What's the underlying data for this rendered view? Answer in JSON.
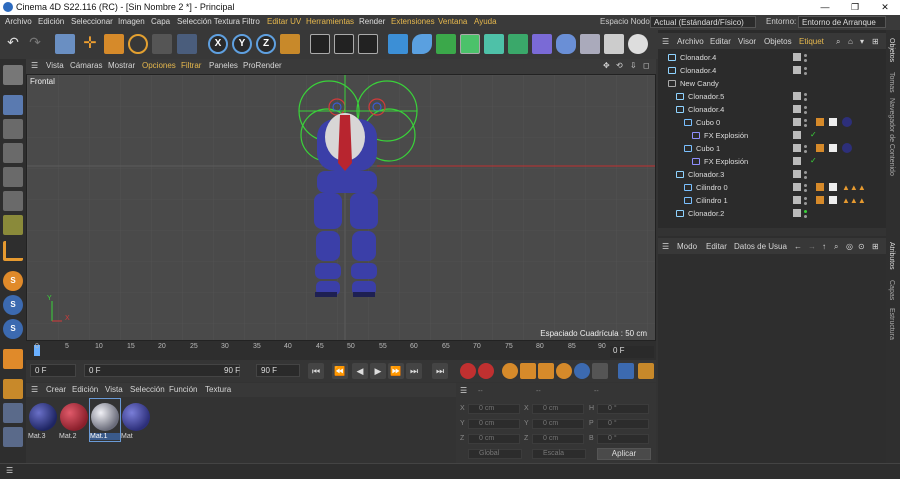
{
  "window": {
    "title": "Cinema 4D S22.116 (RC) - [Sin Nombre 2 *] - Principal",
    "controls": [
      "—",
      "❐",
      "✕"
    ]
  },
  "menubar": {
    "items": [
      "Archivo",
      "Edición",
      "Seleccionar",
      "Imagen",
      "Capa",
      "Selección Textura",
      "Filtro",
      "Editar UV",
      "Herramientas",
      "Render",
      "Extensiones",
      "Ventana",
      "Ayuda"
    ],
    "node_space_label": "Espacio Nodo:",
    "node_space_value": "Actual (Estándard/Físico)",
    "layout_label": "Entorno:",
    "layout_value": "Entorno de Arranque",
    "colors": {
      "accent": "#e6b84d"
    }
  },
  "toolbar": {
    "axis_labels": [
      "X",
      "Y",
      "Z"
    ]
  },
  "viewport": {
    "menu": [
      "Vista",
      "Cámaras",
      "Mostrar",
      "Opciones",
      "Filtrar",
      "Paneles",
      "ProRender"
    ],
    "view_name": "Frontal",
    "grid_spacing": "Espaciado Cuadrícula : 50 cm",
    "axis_x": "X",
    "axis_y": "Y",
    "nav_icons": [
      "✥",
      "⟲",
      "⇩",
      "◻"
    ]
  },
  "timeline": {
    "ticks": [
      "0",
      "5",
      "10",
      "15",
      "20",
      "25",
      "30",
      "35",
      "40",
      "45",
      "50",
      "55",
      "60",
      "65",
      "70",
      "75",
      "80",
      "85",
      "90"
    ],
    "current_frame": "0 F"
  },
  "playback": {
    "start": "0 F",
    "current": "0 F",
    "end_range": "90 F",
    "end": "90 F",
    "buttons": [
      "⏮",
      "⏪",
      "◀",
      "▶",
      "⏩",
      "⏭",
      "⏭"
    ]
  },
  "materials": {
    "menu": [
      "Crear",
      "Edición",
      "Vista",
      "Selección",
      "Función",
      "Textura"
    ],
    "items": [
      {
        "name": "Mat.3",
        "color": "#1e2563"
      },
      {
        "name": "Mat.2",
        "color": "#8a1f2b"
      },
      {
        "name": "Mat.1",
        "color": "#9ea0ad"
      },
      {
        "name": "Mat",
        "color": "#2d2f7a"
      }
    ]
  },
  "coords": {
    "header": [
      "--",
      "--",
      "--"
    ],
    "rows": [
      {
        "a": "X",
        "av": "0 cm",
        "b": "X",
        "bv": "0 cm",
        "c": "H",
        "cv": "0 °"
      },
      {
        "a": "Y",
        "av": "0 cm",
        "b": "Y",
        "bv": "0 cm",
        "c": "P",
        "cv": "0 °"
      },
      {
        "a": "Z",
        "av": "0 cm",
        "b": "Z",
        "bv": "0 cm",
        "c": "B",
        "cv": "0 °"
      }
    ],
    "mode1": "Global",
    "mode2": "Escala",
    "apply": "Aplicar"
  },
  "objects": {
    "menu": [
      "Archivo",
      "Editar",
      "Visor",
      "Objetos",
      "Etiquet"
    ],
    "rows": [
      {
        "name": "Clonador.4",
        "indent": 0
      },
      {
        "name": "Clonador.4",
        "indent": 0
      },
      {
        "name": "New Candy",
        "indent": 0
      },
      {
        "name": "Clonador.5",
        "indent": 1
      },
      {
        "name": "Clonador.4",
        "indent": 1
      },
      {
        "name": "Cubo 0",
        "indent": 2
      },
      {
        "name": "FX Explosión",
        "indent": 3
      },
      {
        "name": "Cubo 1",
        "indent": 2
      },
      {
        "name": "FX Explosión",
        "indent": 3
      },
      {
        "name": "Clonador.3",
        "indent": 1
      },
      {
        "name": "Cilindro 0",
        "indent": 2
      },
      {
        "name": "Cilindro 1",
        "indent": 2
      },
      {
        "name": "Clonador.2",
        "indent": 1
      }
    ]
  },
  "attributes": {
    "menu": [
      "Modo",
      "Editar",
      "Datos de Usua"
    ]
  },
  "sidetabs": {
    "top": [
      "Objetos",
      "Tomas",
      "Navegador de Contenido"
    ],
    "bottom": [
      "Atributos",
      "Capas",
      "Estructura"
    ]
  }
}
